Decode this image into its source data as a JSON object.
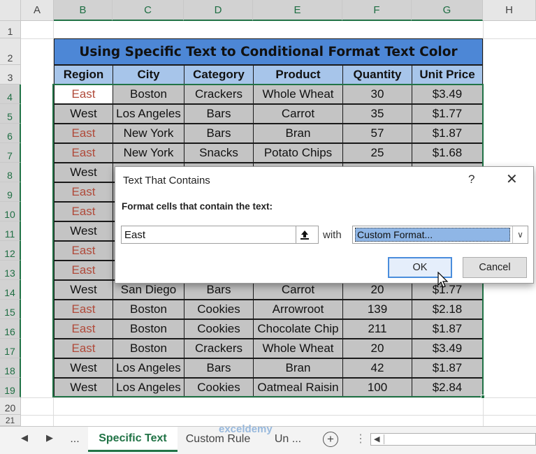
{
  "sheet": {
    "columns": [
      "A",
      "B",
      "C",
      "D",
      "E",
      "F",
      "G",
      "H"
    ],
    "rows": [
      "1",
      "2",
      "3",
      "4",
      "5",
      "6",
      "7",
      "8",
      "9",
      "10",
      "11",
      "12",
      "13",
      "14",
      "15",
      "16",
      "17",
      "18",
      "19",
      "20",
      "21"
    ]
  },
  "table": {
    "title": "Using Specific Text to Conditional Format Text Color",
    "headers": [
      "Region",
      "City",
      "Category",
      "Product",
      "Quantity",
      "Unit Price"
    ],
    "rows": [
      [
        "East",
        "Boston",
        "Crackers",
        "Whole Wheat",
        "30",
        "$3.49"
      ],
      [
        "West",
        "Los Angeles",
        "Bars",
        "Carrot",
        "35",
        "$1.77"
      ],
      [
        "East",
        "New York",
        "Bars",
        "Bran",
        "57",
        "$1.87"
      ],
      [
        "East",
        "New York",
        "Snacks",
        "Potato Chips",
        "25",
        "$1.68"
      ],
      [
        "West",
        "",
        "",
        "",
        "",
        ""
      ],
      [
        "East",
        "",
        "",
        "",
        "",
        ""
      ],
      [
        "East",
        "",
        "",
        "",
        "",
        ""
      ],
      [
        "West",
        "",
        "",
        "",
        "",
        ""
      ],
      [
        "East",
        "",
        "",
        "",
        "",
        ""
      ],
      [
        "East",
        "",
        "",
        "",
        "",
        ""
      ],
      [
        "West",
        "San Diego",
        "Bars",
        "Carrot",
        "20",
        "$1.77"
      ],
      [
        "East",
        "Boston",
        "Cookies",
        "Arrowroot",
        "139",
        "$2.18"
      ],
      [
        "East",
        "Boston",
        "Cookies",
        "Chocolate Chip",
        "211",
        "$1.87"
      ],
      [
        "East",
        "Boston",
        "Crackers",
        "Whole Wheat",
        "20",
        "$3.49"
      ],
      [
        "West",
        "Los Angeles",
        "Bars",
        "Bran",
        "42",
        "$1.87"
      ],
      [
        "West",
        "Los Angeles",
        "Cookies",
        "Oatmeal Raisin",
        "100",
        "$2.84"
      ]
    ]
  },
  "dialog": {
    "title": "Text That Contains",
    "help_glyph": "?",
    "close_glyph": "✕",
    "label": "Format cells that contain the text:",
    "input_value": "East",
    "with_label": "with",
    "format_value": "Custom Format...",
    "ok_label": "OK",
    "cancel_label": "Cancel"
  },
  "tabs": {
    "ellipsis": "...",
    "items": [
      "Specific Text",
      "Custom Rule",
      "Un ..."
    ],
    "active": "Specific Text"
  },
  "watermark": "exceldemy",
  "colors": {
    "title_bg": "#4d87d6",
    "header_bg": "#a7c5ea",
    "cell_bg": "#c4c4c4",
    "east_text": "#b04a3a",
    "excel_green": "#217346"
  }
}
